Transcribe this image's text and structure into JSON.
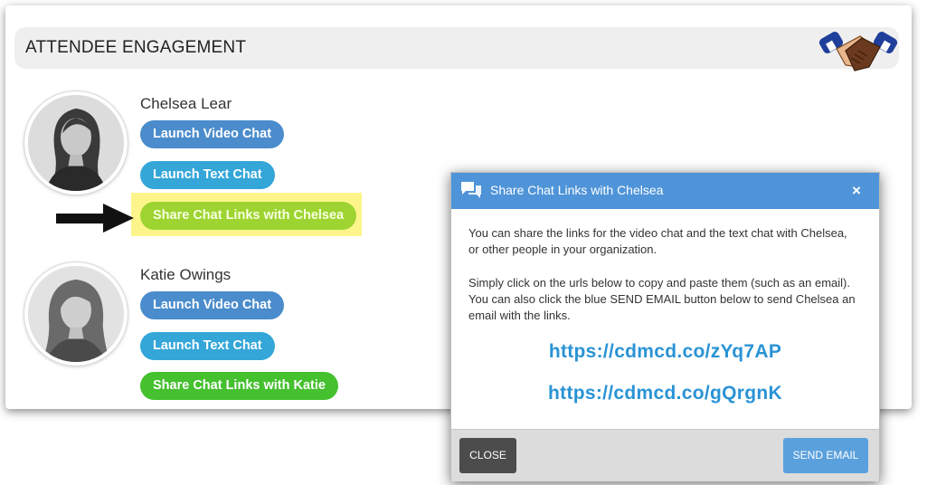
{
  "card": {
    "title": "ATTENDEE ENGAGEMENT",
    "icon": "handshake-icon"
  },
  "attendees": [
    {
      "name": "Chelsea Lear",
      "video_chat": "Launch Video Chat",
      "text_chat": "Launch Text Chat",
      "share_links": "Share Chat Links with Chelsea"
    },
    {
      "name": "Katie Owings",
      "video_chat": "Launch Video Chat",
      "text_chat": "Launch Text Chat",
      "share_links": "Share Chat Links with Katie"
    }
  ],
  "modal": {
    "title": "Share Chat Links with Chelsea",
    "close_symbol": "×",
    "paragraph1": "You can share the links for the video chat and the text chat with Chelsea, or other people in your organization.",
    "paragraph2": "Simply click on the urls below to copy and paste them (such as an email). You can also click the blue SEND EMAIL button below to send Chelsea an email with the links.",
    "links": [
      "https://cdmcd.co/zYq7AP",
      "https://cdmcd.co/gQrgnK"
    ],
    "close_button": "CLOSE",
    "send_button": "SEND EMAIL"
  },
  "colors": {
    "video_chat": "#4a8ccc",
    "text_chat": "#34a6d8",
    "share_highlighted": "#9dd431",
    "share_green": "#45c02f",
    "modal_header": "#4f94d8",
    "link": "#2a93d5",
    "highlight": "#fdf58a"
  }
}
